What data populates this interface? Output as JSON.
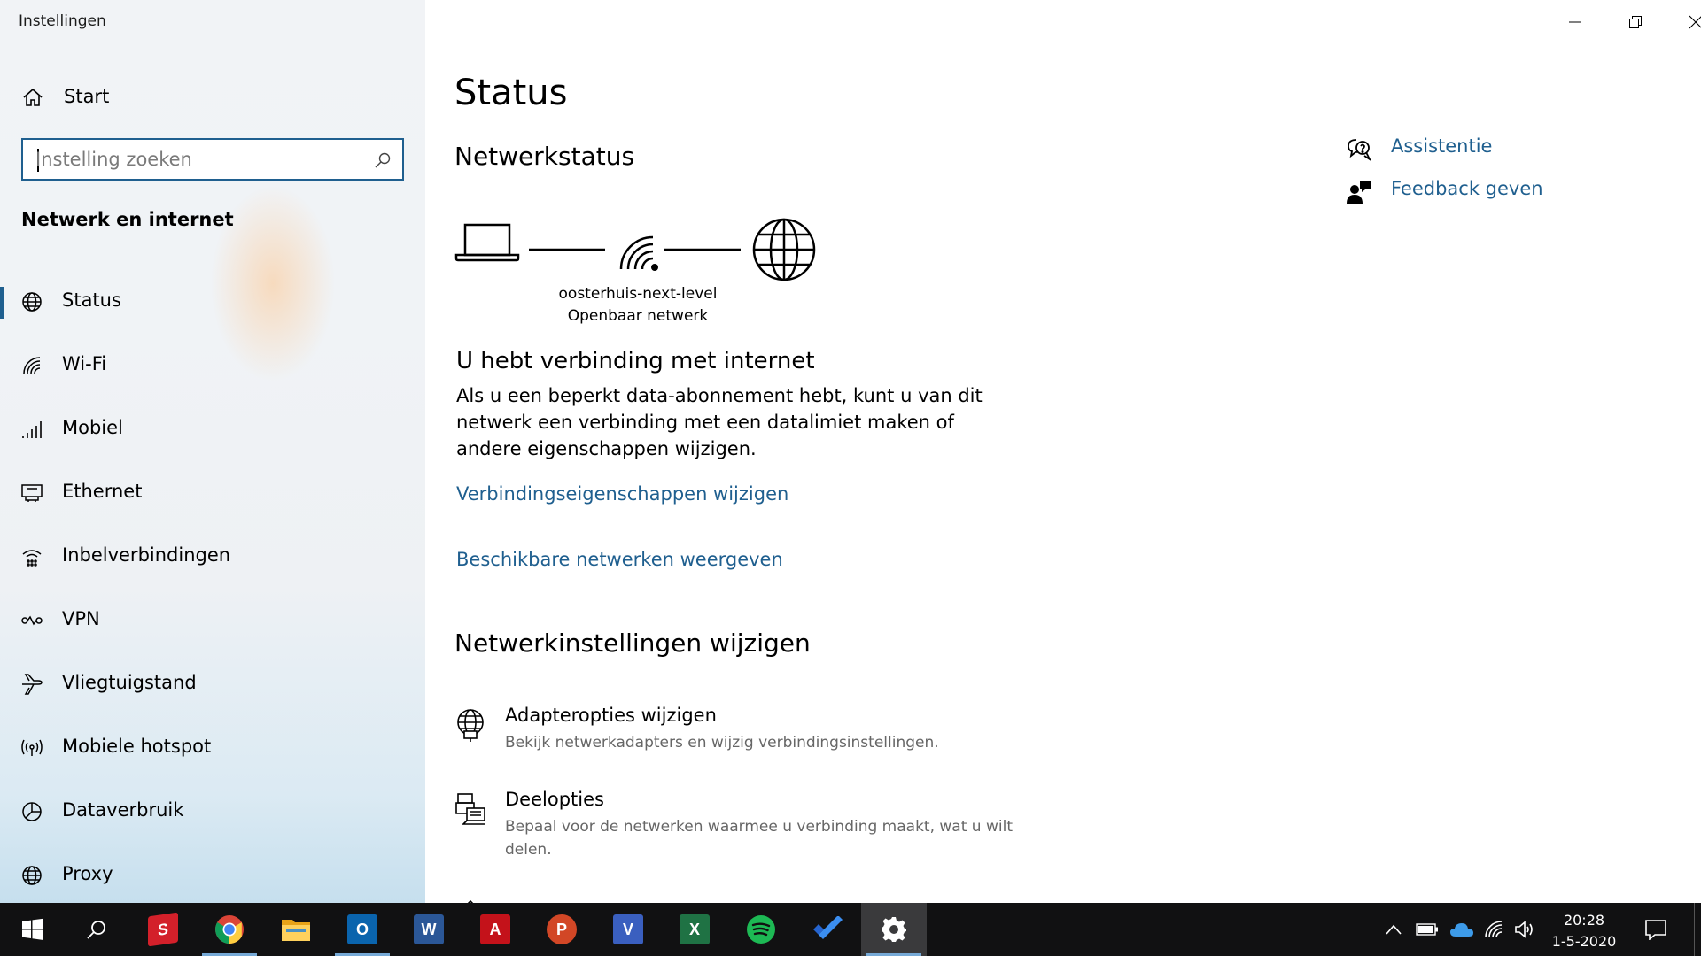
{
  "window": {
    "title": "Instellingen"
  },
  "sidebar": {
    "home_label": "Start",
    "search": {
      "placeholder": "Instelling zoeken",
      "value": ""
    },
    "section_title": "Netwerk en internet",
    "items": [
      {
        "label": "Status",
        "icon": "status-globe-icon",
        "active": true
      },
      {
        "label": "Wi-Fi",
        "icon": "wifi-icon"
      },
      {
        "label": "Mobiel",
        "icon": "cellular-icon"
      },
      {
        "label": "Ethernet",
        "icon": "ethernet-icon"
      },
      {
        "label": "Inbelverbindingen",
        "icon": "dialup-icon"
      },
      {
        "label": "VPN",
        "icon": "vpn-icon"
      },
      {
        "label": "Vliegtuigstand",
        "icon": "airplane-icon"
      },
      {
        "label": "Mobiele hotspot",
        "icon": "hotspot-icon"
      },
      {
        "label": "Dataverbruik",
        "icon": "data-usage-icon"
      },
      {
        "label": "Proxy",
        "icon": "proxy-globe-icon"
      }
    ]
  },
  "main": {
    "title": "Status",
    "network_status_heading": "Netwerkstatus",
    "network": {
      "name": "oosterhuis-next-level",
      "type": "Openbaar netwerk"
    },
    "connection_title": "U hebt verbinding met internet",
    "connection_description": "Als u een beperkt data-abonnement hebt, kunt u van dit netwerk een verbinding met een datalimiet maken of andere eigenschappen wijzigen.",
    "link_properties": "Verbindingseigenschappen wijzigen",
    "link_available": "Beschikbare netwerken weergeven",
    "change_settings_heading": "Netwerkinstellingen wijzigen",
    "settings": [
      {
        "title": "Adapteropties wijzigen",
        "description": "Bekijk netwerkadapters en wijzig verbindingsinstellingen.",
        "icon": "adapter-icon"
      },
      {
        "title": "Deelopties",
        "description": "Bepaal voor de netwerken waarmee u verbinding maakt, wat u wilt delen.",
        "icon": "sharing-icon"
      }
    ],
    "related": [
      {
        "label": "Assistentie",
        "icon": "help-chat-icon"
      },
      {
        "label": "Feedback geven",
        "icon": "feedback-icon"
      }
    ]
  },
  "taskbar": {
    "apps": [
      {
        "name": "start-icon"
      },
      {
        "name": "search-icon"
      },
      {
        "name": "sketchup-icon"
      },
      {
        "name": "chrome-icon",
        "running": true
      },
      {
        "name": "file-explorer-icon"
      },
      {
        "name": "outlook-icon",
        "running": true
      },
      {
        "name": "word-icon"
      },
      {
        "name": "acrobat-icon"
      },
      {
        "name": "powerpoint-icon"
      },
      {
        "name": "visio-icon"
      },
      {
        "name": "excel-icon"
      },
      {
        "name": "spotify-icon"
      },
      {
        "name": "todo-icon"
      },
      {
        "name": "settings-icon",
        "running": true,
        "active": true
      }
    ],
    "clock": {
      "time": "20:28",
      "date": "1-5-2020"
    },
    "colors": {
      "accent": "#1f5f8f",
      "taskbar": "#111112",
      "link": "#1f5f8f"
    }
  }
}
